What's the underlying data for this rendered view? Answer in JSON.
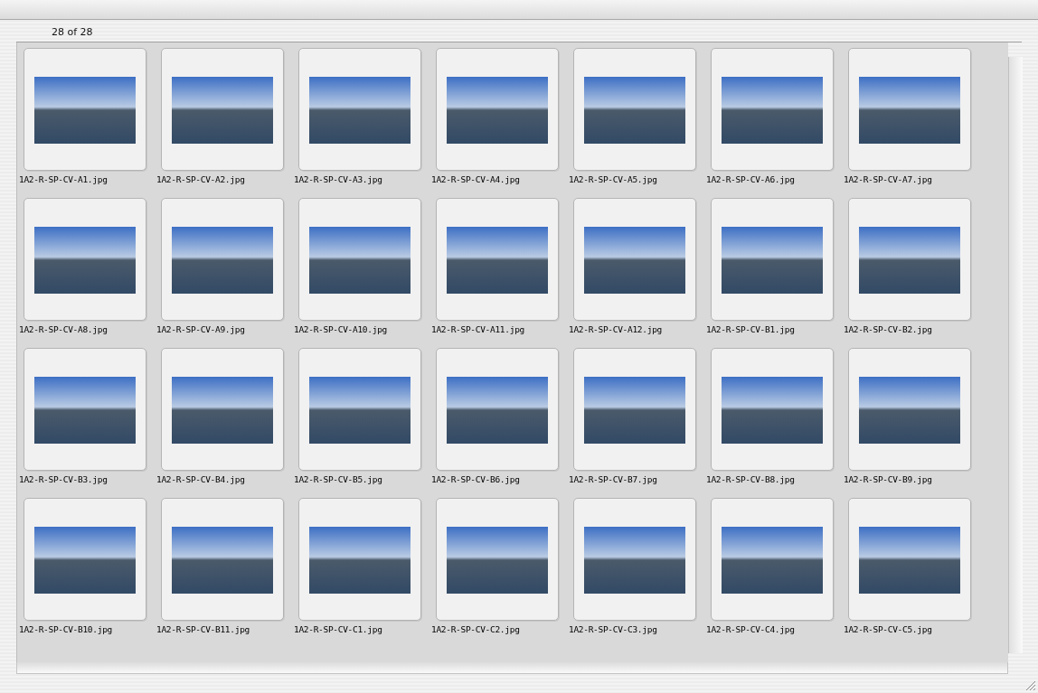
{
  "header": {
    "count": "28 of 28"
  },
  "images": [
    {
      "filename": "1A2-R-SP-CV-A1.jpg"
    },
    {
      "filename": "1A2-R-SP-CV-A2.jpg"
    },
    {
      "filename": "1A2-R-SP-CV-A3.jpg"
    },
    {
      "filename": "1A2-R-SP-CV-A4.jpg"
    },
    {
      "filename": "1A2-R-SP-CV-A5.jpg"
    },
    {
      "filename": "1A2-R-SP-CV-A6.jpg"
    },
    {
      "filename": "1A2-R-SP-CV-A7.jpg"
    },
    {
      "filename": "1A2-R-SP-CV-A8.jpg"
    },
    {
      "filename": "1A2-R-SP-CV-A9.jpg"
    },
    {
      "filename": "1A2-R-SP-CV-A10.jpg"
    },
    {
      "filename": "1A2-R-SP-CV-A11.jpg"
    },
    {
      "filename": "1A2-R-SP-CV-A12.jpg"
    },
    {
      "filename": "1A2-R-SP-CV-B1.jpg"
    },
    {
      "filename": "1A2-R-SP-CV-B2.jpg"
    },
    {
      "filename": "1A2-R-SP-CV-B3.jpg"
    },
    {
      "filename": "1A2-R-SP-CV-B4.jpg"
    },
    {
      "filename": "1A2-R-SP-CV-B5.jpg"
    },
    {
      "filename": "1A2-R-SP-CV-B6.jpg"
    },
    {
      "filename": "1A2-R-SP-CV-B7.jpg"
    },
    {
      "filename": "1A2-R-SP-CV-B8.jpg"
    },
    {
      "filename": "1A2-R-SP-CV-B9.jpg"
    },
    {
      "filename": "1A2-R-SP-CV-B10.jpg"
    },
    {
      "filename": "1A2-R-SP-CV-B11.jpg"
    },
    {
      "filename": "1A2-R-SP-CV-C1.jpg"
    },
    {
      "filename": "1A2-R-SP-CV-C2.jpg"
    },
    {
      "filename": "1A2-R-SP-CV-C3.jpg"
    },
    {
      "filename": "1A2-R-SP-CV-C4.jpg"
    },
    {
      "filename": "1A2-R-SP-CV-C5.jpg"
    }
  ]
}
